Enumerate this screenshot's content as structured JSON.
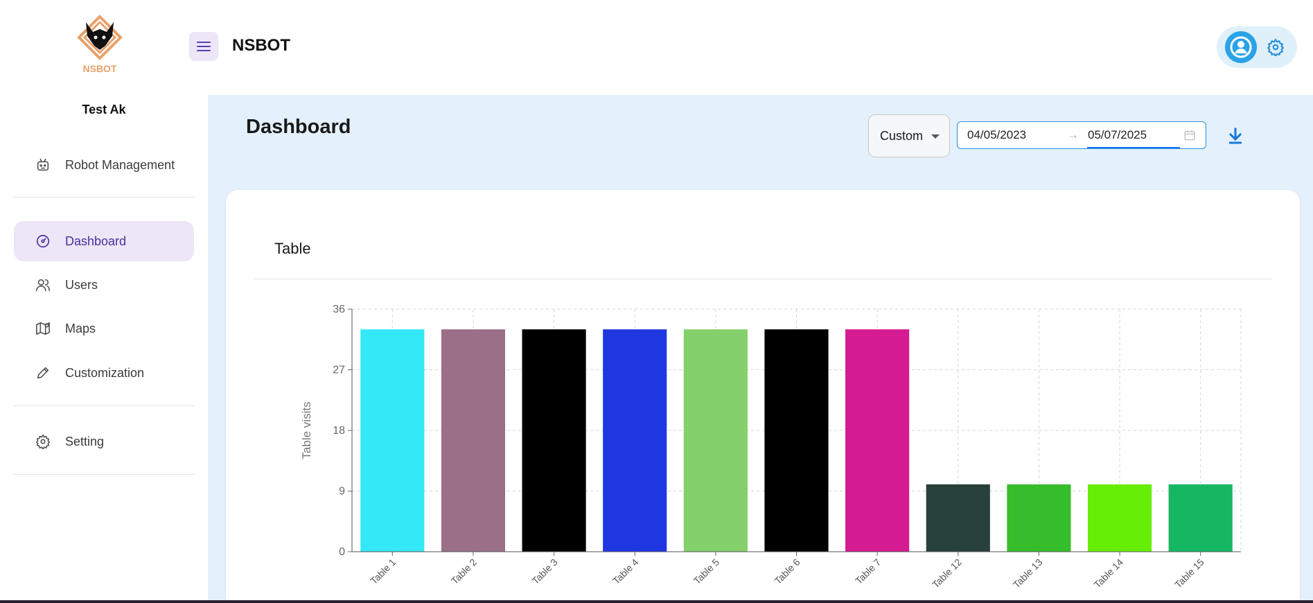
{
  "app": {
    "title": "NSBOT",
    "logo_text": "NSBOT"
  },
  "user": {
    "name": "Test Ak"
  },
  "sidebar": {
    "items": [
      {
        "label": "Robot Management",
        "icon": "robot-icon",
        "active": false
      },
      {
        "label": "Dashboard",
        "icon": "dashboard-icon",
        "active": true
      },
      {
        "label": "Users",
        "icon": "users-icon",
        "active": false
      },
      {
        "label": "Maps",
        "icon": "map-icon",
        "active": false
      },
      {
        "label": "Customization",
        "icon": "pencil-icon",
        "active": false
      },
      {
        "label": "Setting",
        "icon": "gear-icon",
        "active": false
      }
    ]
  },
  "main": {
    "page_title": "Dashboard",
    "range_select": {
      "value": "Custom"
    },
    "date_range": {
      "start": "04/05/2023",
      "arrow": "→",
      "end": "05/07/2025"
    },
    "card": {
      "title": "Table"
    }
  },
  "colors": {
    "accent": "#4b2ea0",
    "primary_blue": "#2aa3e8",
    "main_bg": "#e4f1fc"
  },
  "chart_data": {
    "type": "bar",
    "categories": [
      "Table 1",
      "Table 2",
      "Table 3",
      "Table 4",
      "Table 5",
      "Table 6",
      "Table 7",
      "Table 12",
      "Table 13",
      "Table 14",
      "Table 15"
    ],
    "values": [
      33,
      33,
      33,
      33,
      33,
      33,
      33,
      10,
      10,
      10,
      10
    ],
    "colors": [
      "#33e8f7",
      "#9b6f88",
      "#000000",
      "#1f37e0",
      "#84d06a",
      "#000000",
      "#d41b91",
      "#27403a",
      "#35bd2c",
      "#66ee07",
      "#15b763"
    ],
    "xlabel": "",
    "ylabel": "Table visits",
    "ylim": [
      0,
      36
    ],
    "yticks": [
      0,
      9,
      18,
      27,
      36
    ],
    "grid": true
  }
}
